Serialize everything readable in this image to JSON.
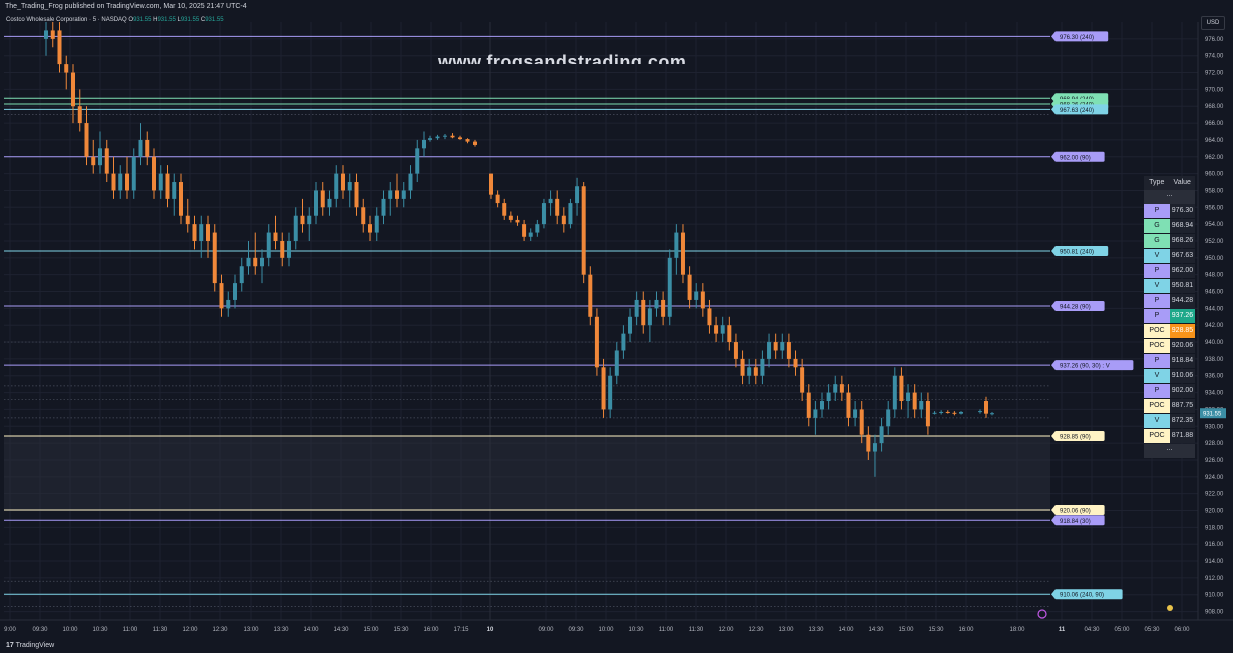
{
  "header": {
    "publish_text": "The_Trading_Frog published on TradingView.com, Mar 10, 2025 21:47 UTC-4"
  },
  "legend": {
    "symbol_text": "Costco Wholesale Corporation · 5 · NASDAQ",
    "o_label": "O",
    "o_value": "931.55",
    "h_label": "H",
    "h_value": "931.55",
    "l_label": "L",
    "l_value": "931.55",
    "c_label": "C",
    "c_value": "931.55"
  },
  "currency": "USD",
  "watermark": "www.frogsandstrading.com",
  "footer": {
    "logo_glyph": "17",
    "brand": "TradingView"
  },
  "colors": {
    "background": "#131722",
    "up": "#3b8ea5",
    "down": "#f0883a",
    "level_p": "#a89cf7",
    "level_g": "#7fe0b4",
    "level_v": "#7fd3e6",
    "level_poc": "#fff3c4",
    "grid": "#1e2230"
  },
  "table": {
    "header_type": "Type",
    "header_value": "Value",
    "ellipsis": "...",
    "rows": [
      {
        "type": "P",
        "value": "976.30",
        "color": "#a89cf7"
      },
      {
        "type": "G",
        "value": "968.94",
        "color": "#7fe0b4"
      },
      {
        "type": "G",
        "value": "968.26",
        "color": "#7fe0b4"
      },
      {
        "type": "V",
        "value": "967.63",
        "color": "#7fd3e6"
      },
      {
        "type": "P",
        "value": "962.00",
        "color": "#a89cf7"
      },
      {
        "type": "V",
        "value": "950.81",
        "color": "#7fd3e6"
      },
      {
        "type": "P",
        "value": "944.28",
        "color": "#a89cf7"
      },
      {
        "type": "P",
        "value": "937.26",
        "color": "#a89cf7",
        "value_bg": "#1ea88a"
      },
      {
        "type": "POC",
        "value": "928.85",
        "color": "#fff3c4",
        "value_bg": "#f7931a"
      },
      {
        "type": "POC",
        "value": "920.06",
        "color": "#fff3c4"
      },
      {
        "type": "P",
        "value": "918.84",
        "color": "#a89cf7"
      },
      {
        "type": "V",
        "value": "910.06",
        "color": "#7fd3e6"
      },
      {
        "type": "P",
        "value": "902.00",
        "color": "#a89cf7"
      },
      {
        "type": "POC",
        "value": "887.75",
        "color": "#fff3c4"
      },
      {
        "type": "V",
        "value": "872.35",
        "color": "#7fd3e6"
      },
      {
        "type": "POC",
        "value": "871.88",
        "color": "#fff3c4"
      }
    ]
  },
  "chart_data": {
    "type": "candlestick",
    "symbol": "Costco Wholesale Corporation",
    "timeframe": "5",
    "exchange": "NASDAQ",
    "ylim": [
      907,
      978
    ],
    "y_ticks": [
      908,
      910,
      912,
      914,
      916,
      918,
      920,
      922,
      924,
      926,
      928,
      930,
      932,
      934,
      936,
      938,
      940,
      942,
      944,
      946,
      948,
      950,
      952,
      954,
      956,
      958,
      960,
      962,
      964,
      966,
      968,
      970,
      972,
      974,
      976
    ],
    "x_ticks": [
      "9:00",
      "09:30",
      "10:00",
      "10:30",
      "11:00",
      "11:30",
      "12:00",
      "12:30",
      "13:00",
      "13:30",
      "14:00",
      "14:30",
      "15:00",
      "15:30",
      "16:00",
      "17:15",
      "10",
      "09:00",
      "09:30",
      "10:00",
      "10:30",
      "11:00",
      "11:30",
      "12:00",
      "12:30",
      "13:00",
      "13:30",
      "14:00",
      "14:30",
      "15:00",
      "15:30",
      "16:00",
      "18:00",
      "11",
      "04:30",
      "05:00",
      "05:30",
      "06:00"
    ],
    "last_price": "931.55",
    "levels": [
      {
        "label": "976.30 (240)",
        "value": 976.3,
        "color": "#a89cf7"
      },
      {
        "label": "968.94 (240)",
        "value": 968.94,
        "color": "#7fe0b4"
      },
      {
        "label": "968.26 (240)",
        "value": 968.26,
        "color": "#7fe0b4"
      },
      {
        "label": "967.63 (240)",
        "value": 967.63,
        "color": "#7fd3e6"
      },
      {
        "label": "962.00 (90)",
        "value": 962.0,
        "color": "#a89cf7"
      },
      {
        "label": "950.81 (240)",
        "value": 950.81,
        "color": "#7fd3e6"
      },
      {
        "label": "944.28 (90)",
        "value": 944.28,
        "color": "#a89cf7"
      },
      {
        "label": "937.26 (90, 30) : V",
        "value": 937.26,
        "color": "#a89cf7"
      },
      {
        "label": "928.85 (90)",
        "value": 928.85,
        "color": "#fff3c4"
      },
      {
        "label": "920.06 (90)",
        "value": 920.06,
        "color": "#fff3c4"
      },
      {
        "label": "918.84 (30)",
        "value": 918.84,
        "color": "#a89cf7"
      },
      {
        "label": "910.06 (240, 90)",
        "value": 910.06,
        "color": "#7fd3e6"
      }
    ],
    "dotted_levels": [
      967.0,
      940.0,
      934.8,
      933.2,
      931.0,
      911.6,
      908.6
    ],
    "value_area": [
      920.06,
      928.85
    ],
    "candles": [
      {
        "o": 976,
        "h": 978,
        "l": 974,
        "c": 977
      },
      {
        "o": 977,
        "h": 978,
        "l": 975,
        "c": 976
      },
      {
        "o": 977,
        "h": 978,
        "l": 972,
        "c": 973
      },
      {
        "o": 973,
        "h": 974,
        "l": 970,
        "c": 972
      },
      {
        "o": 972,
        "h": 973,
        "l": 966,
        "c": 968
      },
      {
        "o": 968,
        "h": 970,
        "l": 965,
        "c": 966
      },
      {
        "o": 966,
        "h": 968,
        "l": 961,
        "c": 962
      },
      {
        "o": 962,
        "h": 964,
        "l": 960,
        "c": 961
      },
      {
        "o": 961,
        "h": 965,
        "l": 960,
        "c": 963
      },
      {
        "o": 963,
        "h": 964,
        "l": 959,
        "c": 960
      },
      {
        "o": 960,
        "h": 962,
        "l": 957,
        "c": 958
      },
      {
        "o": 958,
        "h": 961,
        "l": 957,
        "c": 960
      },
      {
        "o": 960,
        "h": 962,
        "l": 957,
        "c": 958
      },
      {
        "o": 958,
        "h": 963,
        "l": 957,
        "c": 962
      },
      {
        "o": 962,
        "h": 966,
        "l": 961,
        "c": 964
      },
      {
        "o": 964,
        "h": 965,
        "l": 961,
        "c": 962
      },
      {
        "o": 962,
        "h": 963,
        "l": 957,
        "c": 958
      },
      {
        "o": 958,
        "h": 961,
        "l": 957,
        "c": 960
      },
      {
        "o": 960,
        "h": 961,
        "l": 956,
        "c": 957
      },
      {
        "o": 957,
        "h": 960,
        "l": 955,
        "c": 959
      },
      {
        "o": 959,
        "h": 960,
        "l": 954,
        "c": 955
      },
      {
        "o": 955,
        "h": 957,
        "l": 953,
        "c": 954
      },
      {
        "o": 954,
        "h": 955,
        "l": 951,
        "c": 952
      },
      {
        "o": 952,
        "h": 955,
        "l": 950,
        "c": 954
      },
      {
        "o": 954,
        "h": 955,
        "l": 950,
        "c": 952
      },
      {
        "o": 953,
        "h": 954,
        "l": 946,
        "c": 947
      },
      {
        "o": 947,
        "h": 948,
        "l": 943,
        "c": 944
      },
      {
        "o": 944,
        "h": 946,
        "l": 943,
        "c": 945
      },
      {
        "o": 945,
        "h": 948,
        "l": 944,
        "c": 947
      },
      {
        "o": 947,
        "h": 950,
        "l": 946,
        "c": 949
      },
      {
        "o": 949,
        "h": 952,
        "l": 948,
        "c": 950
      },
      {
        "o": 950,
        "h": 953,
        "l": 948,
        "c": 949
      },
      {
        "o": 949,
        "h": 951,
        "l": 947,
        "c": 950
      },
      {
        "o": 950,
        "h": 954,
        "l": 949,
        "c": 953
      },
      {
        "o": 953,
        "h": 955,
        "l": 951,
        "c": 952
      },
      {
        "o": 952,
        "h": 953,
        "l": 949,
        "c": 950
      },
      {
        "o": 950,
        "h": 953,
        "l": 949,
        "c": 952
      },
      {
        "o": 952,
        "h": 956,
        "l": 951,
        "c": 955
      },
      {
        "o": 955,
        "h": 957,
        "l": 953,
        "c": 954
      },
      {
        "o": 954,
        "h": 956,
        "l": 952,
        "c": 955
      },
      {
        "o": 955,
        "h": 959,
        "l": 954,
        "c": 958
      },
      {
        "o": 958,
        "h": 959,
        "l": 955,
        "c": 956
      },
      {
        "o": 956,
        "h": 958,
        "l": 955,
        "c": 957
      },
      {
        "o": 957,
        "h": 961,
        "l": 956,
        "c": 960
      },
      {
        "o": 960,
        "h": 961,
        "l": 957,
        "c": 958
      },
      {
        "o": 958,
        "h": 960,
        "l": 956,
        "c": 959
      },
      {
        "o": 959,
        "h": 960,
        "l": 955,
        "c": 956
      },
      {
        "o": 956,
        "h": 957,
        "l": 953,
        "c": 954
      },
      {
        "o": 954,
        "h": 955,
        "l": 952,
        "c": 953
      },
      {
        "o": 953,
        "h": 956,
        "l": 952,
        "c": 955
      },
      {
        "o": 955,
        "h": 958,
        "l": 954,
        "c": 957
      },
      {
        "o": 957,
        "h": 959,
        "l": 955,
        "c": 958
      },
      {
        "o": 958,
        "h": 960,
        "l": 956,
        "c": 957
      },
      {
        "o": 957,
        "h": 959,
        "l": 956,
        "c": 958
      },
      {
        "o": 958,
        "h": 961,
        "l": 957,
        "c": 960
      },
      {
        "o": 960,
        "h": 964,
        "l": 959,
        "c": 963
      },
      {
        "o": 963,
        "h": 965,
        "l": 962,
        "c": 964
      },
      {
        "o": 964,
        "h": 964.5,
        "l": 963.8,
        "c": 964.2
      },
      {
        "o": 964.2,
        "h": 964.6,
        "l": 964,
        "c": 964.4
      },
      {
        "o": 964.4,
        "h": 964.7,
        "l": 964.1,
        "c": 964.5
      },
      {
        "o": 964.5,
        "h": 964.8,
        "l": 964.2,
        "c": 964.3
      },
      {
        "o": 964.3,
        "h": 964.5,
        "l": 964,
        "c": 964.1
      },
      {
        "o": 964.1,
        "h": 964.2,
        "l": 963.6,
        "c": 963.8
      },
      {
        "o": 963.8,
        "h": 964,
        "l": 963.2,
        "c": 963.4
      },
      {
        "o": 960,
        "h": 960,
        "l": 957,
        "c": 957.5
      },
      {
        "o": 957.5,
        "h": 958,
        "l": 956,
        "c": 956.5
      },
      {
        "o": 956.5,
        "h": 957,
        "l": 954.5,
        "c": 955
      },
      {
        "o": 955,
        "h": 955.5,
        "l": 954.2,
        "c": 954.5
      },
      {
        "o": 954.5,
        "h": 955,
        "l": 953.8,
        "c": 954.2
      },
      {
        "o": 954,
        "h": 954.5,
        "l": 952,
        "c": 952.5
      },
      {
        "o": 952.5,
        "h": 953.5,
        "l": 952,
        "c": 953
      },
      {
        "o": 953,
        "h": 954.5,
        "l": 952.5,
        "c": 954
      },
      {
        "o": 954,
        "h": 957,
        "l": 953.5,
        "c": 956.5
      },
      {
        "o": 956.5,
        "h": 958,
        "l": 955,
        "c": 957
      },
      {
        "o": 957,
        "h": 958,
        "l": 954,
        "c": 955
      },
      {
        "o": 955,
        "h": 956,
        "l": 953,
        "c": 954
      },
      {
        "o": 954,
        "h": 957,
        "l": 953.5,
        "c": 956.5
      },
      {
        "o": 956.5,
        "h": 959.5,
        "l": 955,
        "c": 958.5
      },
      {
        "o": 958.5,
        "h": 959,
        "l": 947,
        "c": 948
      },
      {
        "o": 948,
        "h": 949,
        "l": 942,
        "c": 943
      },
      {
        "o": 943,
        "h": 944,
        "l": 936,
        "c": 937
      },
      {
        "o": 937,
        "h": 938,
        "l": 931,
        "c": 932
      },
      {
        "o": 932,
        "h": 937,
        "l": 931,
        "c": 936
      },
      {
        "o": 936,
        "h": 940,
        "l": 935,
        "c": 939
      },
      {
        "o": 939,
        "h": 942,
        "l": 938,
        "c": 941
      },
      {
        "o": 941,
        "h": 944,
        "l": 940,
        "c": 943
      },
      {
        "o": 943,
        "h": 946,
        "l": 942,
        "c": 945
      },
      {
        "o": 945,
        "h": 946,
        "l": 941,
        "c": 942
      },
      {
        "o": 942,
        "h": 945,
        "l": 940,
        "c": 944
      },
      {
        "o": 944,
        "h": 946,
        "l": 943,
        "c": 945
      },
      {
        "o": 945,
        "h": 946,
        "l": 942,
        "c": 943
      },
      {
        "o": 943,
        "h": 951,
        "l": 942,
        "c": 950
      },
      {
        "o": 950,
        "h": 954,
        "l": 948,
        "c": 953
      },
      {
        "o": 953,
        "h": 954,
        "l": 947,
        "c": 948
      },
      {
        "o": 948,
        "h": 949,
        "l": 944,
        "c": 945
      },
      {
        "o": 945,
        "h": 947,
        "l": 944,
        "c": 946
      },
      {
        "o": 946,
        "h": 947,
        "l": 943,
        "c": 944
      },
      {
        "o": 944,
        "h": 945,
        "l": 941,
        "c": 942
      },
      {
        "o": 942,
        "h": 943,
        "l": 940,
        "c": 941
      },
      {
        "o": 941,
        "h": 943,
        "l": 940,
        "c": 942
      },
      {
        "o": 942,
        "h": 943,
        "l": 939,
        "c": 940
      },
      {
        "o": 940,
        "h": 941,
        "l": 937,
        "c": 938
      },
      {
        "o": 938,
        "h": 939,
        "l": 935,
        "c": 936
      },
      {
        "o": 936,
        "h": 938,
        "l": 935,
        "c": 937
      },
      {
        "o": 937,
        "h": 938,
        "l": 935,
        "c": 936
      },
      {
        "o": 936,
        "h": 939,
        "l": 935,
        "c": 938
      },
      {
        "o": 938,
        "h": 941,
        "l": 937,
        "c": 940
      },
      {
        "o": 940,
        "h": 941,
        "l": 938,
        "c": 939
      },
      {
        "o": 939,
        "h": 941,
        "l": 938,
        "c": 940
      },
      {
        "o": 940,
        "h": 941,
        "l": 937,
        "c": 938
      },
      {
        "o": 938,
        "h": 939,
        "l": 936,
        "c": 937
      },
      {
        "o": 937,
        "h": 938,
        "l": 933,
        "c": 934
      },
      {
        "o": 934,
        "h": 935,
        "l": 930,
        "c": 931
      },
      {
        "o": 931,
        "h": 933,
        "l": 929,
        "c": 932
      },
      {
        "o": 932,
        "h": 934,
        "l": 931,
        "c": 933
      },
      {
        "o": 933,
        "h": 935,
        "l": 932,
        "c": 934
      },
      {
        "o": 934,
        "h": 936,
        "l": 933,
        "c": 935
      },
      {
        "o": 935,
        "h": 936,
        "l": 933,
        "c": 934
      },
      {
        "o": 934,
        "h": 935,
        "l": 930,
        "c": 931
      },
      {
        "o": 931,
        "h": 933,
        "l": 930,
        "c": 932
      },
      {
        "o": 932,
        "h": 933,
        "l": 928,
        "c": 929
      },
      {
        "o": 929,
        "h": 930,
        "l": 926,
        "c": 927
      },
      {
        "o": 927,
        "h": 929,
        "l": 924,
        "c": 928
      },
      {
        "o": 928,
        "h": 931,
        "l": 927,
        "c": 930
      },
      {
        "o": 930,
        "h": 933,
        "l": 929,
        "c": 932
      },
      {
        "o": 932,
        "h": 937,
        "l": 931,
        "c": 936
      },
      {
        "o": 936,
        "h": 937,
        "l": 932,
        "c": 933
      },
      {
        "o": 933,
        "h": 935,
        "l": 931,
        "c": 934
      },
      {
        "o": 934,
        "h": 935,
        "l": 931,
        "c": 932
      },
      {
        "o": 932,
        "h": 934,
        "l": 931,
        "c": 933
      },
      {
        "o": 933,
        "h": 934,
        "l": 929,
        "c": 930
      },
      {
        "o": 931.6,
        "h": 931.8,
        "l": 931.4,
        "c": 931.6
      },
      {
        "o": 931.6,
        "h": 931.9,
        "l": 931.4,
        "c": 931.7
      },
      {
        "o": 931.7,
        "h": 931.9,
        "l": 931.5,
        "c": 931.6
      },
      {
        "o": 931.6,
        "h": 931.8,
        "l": 931.3,
        "c": 931.5
      },
      {
        "o": 931.5,
        "h": 931.8,
        "l": 931.4,
        "c": 931.7
      },
      {
        "o": 931.7,
        "h": 932,
        "l": 931.5,
        "c": 931.8
      },
      {
        "o": 933,
        "h": 933.5,
        "l": 931,
        "c": 931.5
      },
      {
        "o": 931.5,
        "h": 931.7,
        "l": 931.3,
        "c": 931.55
      }
    ]
  }
}
